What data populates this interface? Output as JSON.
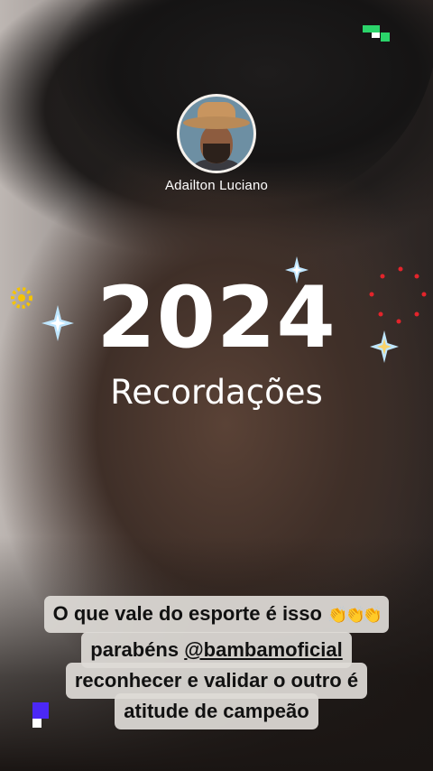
{
  "profile": {
    "author_name": "Adailton Luciano"
  },
  "story_sticker": {
    "year": "2024",
    "label": "Recordações"
  },
  "caption": {
    "line1": "O que vale do esporte é isso",
    "line1_emoji": "👏👏👏",
    "line2_prefix": "parabéns ",
    "line2_mention": "@bambamoficial",
    "line3": "reconhecer e validar o outro é",
    "line4": "atitude de campeão"
  },
  "icons": {
    "top_right": "green-pixel-icon",
    "bottom_left": "blue-pixel-icon",
    "sparkles": "sparkle-icon",
    "flower": "yellow-flower-icon",
    "dots": "red-dot-ring-icon"
  },
  "colors": {
    "green": "#2bd46a",
    "blue": "#4b28f5",
    "red": "#e3242b",
    "yellow": "#f5c400"
  }
}
